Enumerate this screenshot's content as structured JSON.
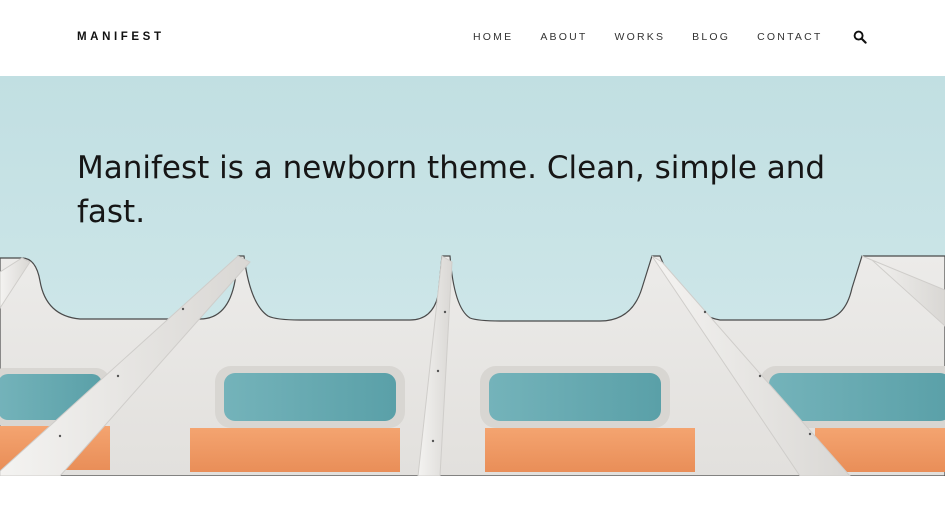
{
  "site": {
    "logo": "MANIFEST"
  },
  "nav": {
    "items": [
      {
        "label": "HOME"
      },
      {
        "label": "ABOUT"
      },
      {
        "label": "WORKS"
      },
      {
        "label": "BLOG"
      },
      {
        "label": "CONTACT"
      }
    ],
    "search_icon": "search-icon"
  },
  "hero": {
    "title": "Manifest is a newborn theme. Clean, simple and fast.",
    "image": "building-facade-image",
    "sky_color": "#c3e0e3",
    "window_glass_color": "#5aa3ab",
    "panel_color": "#f09a66"
  }
}
